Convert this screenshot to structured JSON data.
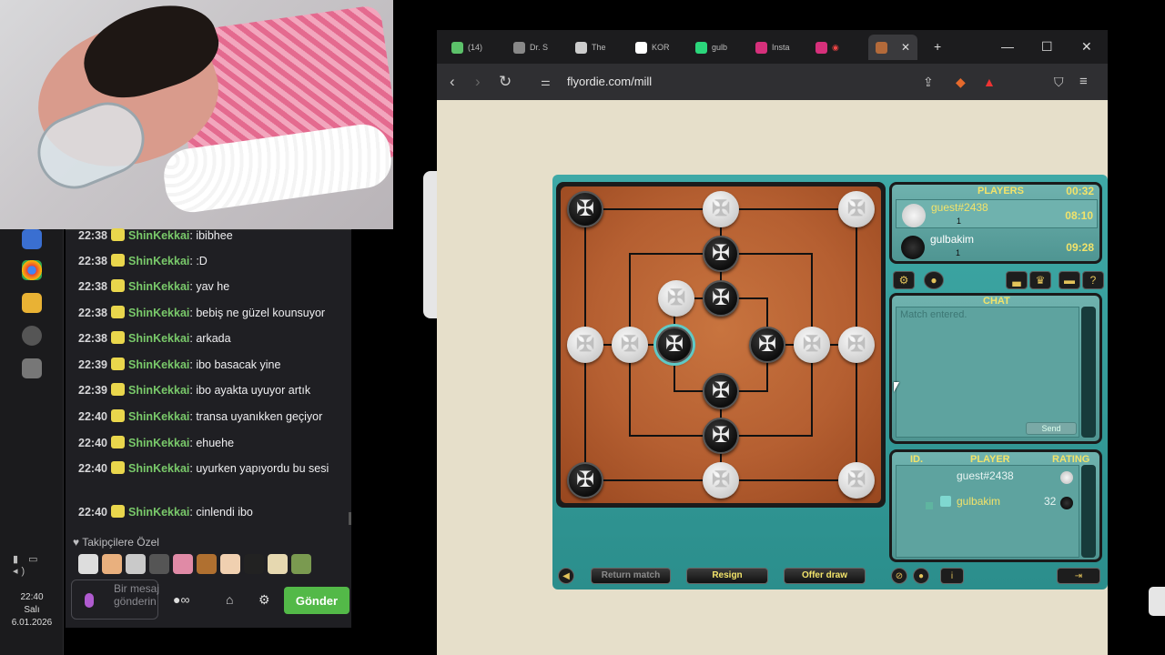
{
  "chat": {
    "messages": [
      {
        "time": "22:38",
        "user": "ShinKekkai",
        "text": "ibibhee"
      },
      {
        "time": "22:38",
        "user": "ShinKekkai",
        "text": ":D"
      },
      {
        "time": "22:38",
        "user": "ShinKekkai",
        "text": "yav he"
      },
      {
        "time": "22:38",
        "user": "ShinKekkai",
        "text": "bebiş ne güzel kounsuyor"
      },
      {
        "time": "22:38",
        "user": "ShinKekkai",
        "text": "arkada"
      },
      {
        "time": "22:39",
        "user": "ShinKekkai",
        "text": "ibo basacak yine"
      },
      {
        "time": "22:39",
        "user": "ShinKekkai",
        "text": "ibo ayakta uyuyor artık"
      },
      {
        "time": "22:40",
        "user": "ShinKekkai",
        "text": "transa uyanıkken geçiyor"
      },
      {
        "time": "22:40",
        "user": "ShinKekkai",
        "text": "ehuehe"
      },
      {
        "time": "22:40",
        "user": "ShinKekkai",
        "text": "uyurken yapıyordu bu sesi"
      },
      {
        "time": "22:40",
        "user": "ShinKekkai",
        "text": "cinlendi ibo"
      }
    ],
    "followers_label": "Takipçilere Özel",
    "input_placeholder": "Bir mesaj gönderin",
    "send_label": "Gönder"
  },
  "taskbar": {
    "time": "22:40",
    "day": "Salı",
    "date": "6.01.2026"
  },
  "browser": {
    "tabs": [
      "(14)",
      "Dr. S",
      "The",
      "KOR",
      "gulb",
      "Insta"
    ],
    "url": "flyordie.com/mill"
  },
  "game": {
    "players_title": "PLAYERS",
    "timer": "00:32",
    "players": [
      {
        "name": "guest#2438",
        "rating": "1",
        "time": "08:10",
        "color": "white"
      },
      {
        "name": "gulbakim",
        "rating": "1",
        "time": "09:28",
        "color": "black"
      }
    ],
    "chat_title": "CHAT",
    "chat_log": "Match entered.",
    "send_label": "Send",
    "list_headers": {
      "id": "ID.",
      "player": "PLAYER",
      "rating": "RATING"
    },
    "list": [
      {
        "name": "guest#2438",
        "rating": ""
      },
      {
        "name": "gulbakim",
        "rating": "32"
      }
    ],
    "buttons": {
      "return_match": "Return match",
      "resign": "Resign",
      "offer_draw": "Offer draw"
    },
    "colors": {
      "accent": "#f2e36a",
      "teal": "#3fa9a6",
      "board": "#b55f31"
    }
  }
}
